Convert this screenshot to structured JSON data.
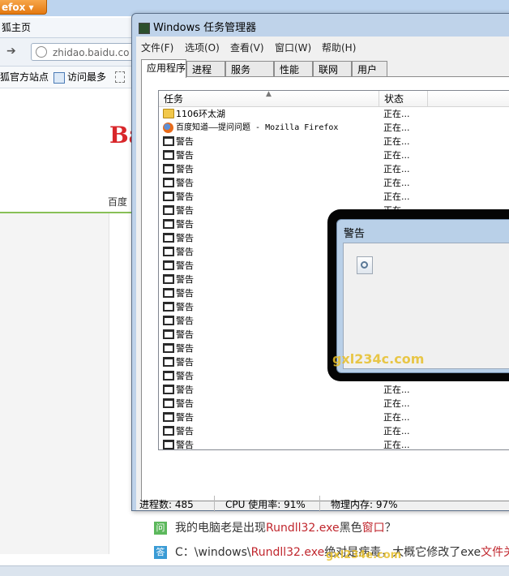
{
  "firefox": {
    "menu_button": "efox",
    "tab_title": "狐主页",
    "url": "zhidao.baidu.co",
    "bookmarks": [
      "狐官方站点",
      "访问最多"
    ],
    "logo_fragment": "Ba",
    "nav_fragment": "百度"
  },
  "task_manager": {
    "title": "Windows 任务管理器",
    "menu": [
      "文件(F)",
      "选项(O)",
      "查看(V)",
      "窗口(W)",
      "帮助(H)"
    ],
    "tabs": [
      "应用程序",
      "进程",
      "服务",
      "性能",
      "联网",
      "用户"
    ],
    "active_tab": "应用程序",
    "columns": {
      "task": "任务",
      "status": "状态"
    },
    "rows": [
      {
        "icon": "folder-icon",
        "task": "1106环太湖",
        "status": "正在..."
      },
      {
        "icon": "firefox-icon",
        "task": "百度知道——提问问题 - Mozilla Firefox",
        "status": "正在..."
      },
      {
        "icon": "window-icon",
        "task": "警告",
        "status": "正在..."
      },
      {
        "icon": "window-icon",
        "task": "警告",
        "status": "正在..."
      },
      {
        "icon": "window-icon",
        "task": "警告",
        "status": "正在..."
      },
      {
        "icon": "window-icon",
        "task": "警告",
        "status": "正在..."
      },
      {
        "icon": "window-icon",
        "task": "警告",
        "status": "正在..."
      },
      {
        "icon": "window-icon",
        "task": "警告",
        "status": "正在..."
      },
      {
        "icon": "window-icon",
        "task": "警告",
        "status": ""
      },
      {
        "icon": "window-icon",
        "task": "警告",
        "status": ""
      },
      {
        "icon": "window-icon",
        "task": "警告",
        "status": ""
      },
      {
        "icon": "window-icon",
        "task": "警告",
        "status": ""
      },
      {
        "icon": "window-icon",
        "task": "警告",
        "status": ""
      },
      {
        "icon": "window-icon",
        "task": "警告",
        "status": ""
      },
      {
        "icon": "window-icon",
        "task": "警告",
        "status": ""
      },
      {
        "icon": "window-icon",
        "task": "警告",
        "status": ""
      },
      {
        "icon": "window-icon",
        "task": "警告",
        "status": ""
      },
      {
        "icon": "window-icon",
        "task": "警告",
        "status": ""
      },
      {
        "icon": "window-icon",
        "task": "警告",
        "status": ""
      },
      {
        "icon": "window-icon",
        "task": "警告",
        "status": ""
      },
      {
        "icon": "window-icon",
        "task": "警告",
        "status": "正在..."
      },
      {
        "icon": "window-icon",
        "task": "警告",
        "status": "正在..."
      },
      {
        "icon": "window-icon",
        "task": "警告",
        "status": "正在..."
      },
      {
        "icon": "window-icon",
        "task": "警告",
        "status": "正在..."
      },
      {
        "icon": "window-icon",
        "task": "警告",
        "status": "正在..."
      },
      {
        "icon": "window-icon",
        "task": "警告",
        "status": "正在..."
      }
    ],
    "statusbar": {
      "processes": "进程数: 485",
      "cpu": "CPU 使用率: 91%",
      "memory": "物理内存: 97%"
    }
  },
  "warning_dialog": {
    "title": "警告"
  },
  "qa": {
    "question_badge": "问",
    "question_parts": [
      "我的电脑老是出现",
      "Rundll32.exe",
      "黑色",
      "窗口",
      "？"
    ],
    "answer_badge": "答",
    "answer_parts": [
      "C：\\windows\\",
      "Rundll32.exe",
      "绝对是病毒，大概它修改了exe",
      "文件关"
    ]
  },
  "watermark": {
    "middle": "gxl234c.com",
    "bottom": "gxl234e.com"
  },
  "colors": {
    "accent_red": "#c0262d",
    "tm_frame": "#bfd3ea",
    "firefox_orange": "#e47911"
  }
}
